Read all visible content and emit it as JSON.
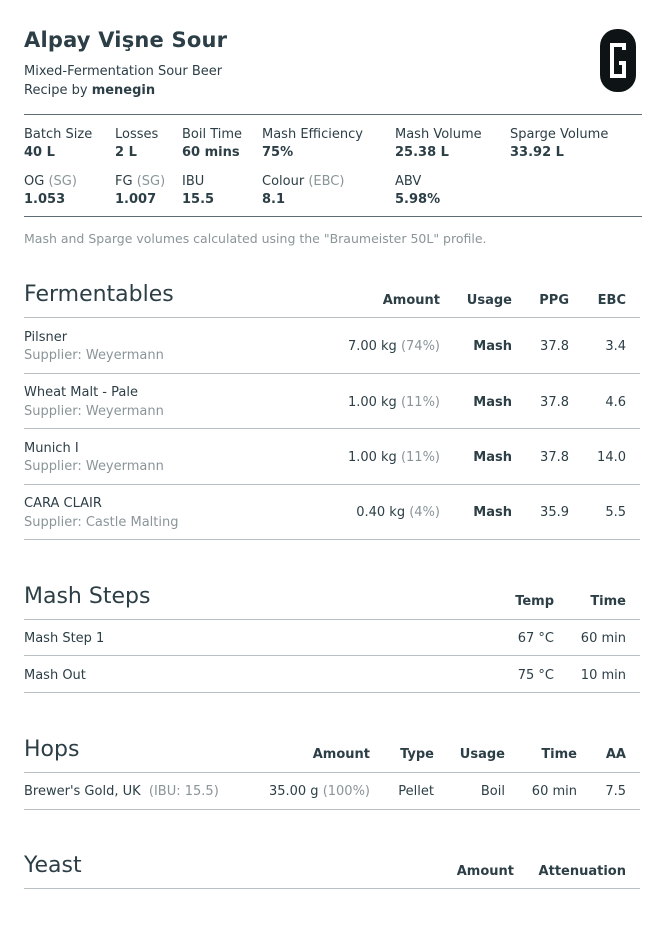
{
  "recipe": {
    "title": "Alpay Vişne Sour",
    "style": "Mixed-Fermentation Sour Beer",
    "byline_prefix": "Recipe by",
    "author": "menegin",
    "logo_icon": "brand-g-logo-icon"
  },
  "stats": {
    "batch_size": {
      "label": "Batch Size",
      "value": "40 L"
    },
    "losses": {
      "label": "Losses",
      "value": "2 L"
    },
    "boil_time": {
      "label": "Boil Time",
      "value": "60 mins"
    },
    "mash_efficiency": {
      "label": "Mash Efficiency",
      "value": "75%"
    },
    "mash_volume": {
      "label": "Mash Volume",
      "value": "25.38 L"
    },
    "sparge_volume": {
      "label": "Sparge Volume",
      "value": "33.92 L"
    },
    "og": {
      "label": "OG",
      "unit": "(SG)",
      "value": "1.053"
    },
    "fg": {
      "label": "FG",
      "unit": "(SG)",
      "value": "1.007"
    },
    "ibu": {
      "label": "IBU",
      "value": "15.5"
    },
    "colour": {
      "label": "Colour",
      "unit": "(EBC)",
      "value": "8.1"
    },
    "abv": {
      "label": "ABV",
      "value": "5.98%"
    }
  },
  "note": "Mash and Sparge volumes calculated using the \"Braumeister 50L\" profile.",
  "fermentables": {
    "title": "Fermentables",
    "headers": {
      "amount": "Amount",
      "usage": "Usage",
      "ppg": "PPG",
      "ebc": "EBC"
    },
    "rows": [
      {
        "name": "Pilsner",
        "supplier": "Supplier: Weyermann",
        "amount": "7.00 kg",
        "pct": "(74%)",
        "usage": "Mash",
        "ppg": "37.8",
        "ebc": "3.4"
      },
      {
        "name": "Wheat Malt - Pale",
        "supplier": "Supplier: Weyermann",
        "amount": "1.00 kg",
        "pct": "(11%)",
        "usage": "Mash",
        "ppg": "37.8",
        "ebc": "4.6"
      },
      {
        "name": "Munich I",
        "supplier": "Supplier: Weyermann",
        "amount": "1.00 kg",
        "pct": "(11%)",
        "usage": "Mash",
        "ppg": "37.8",
        "ebc": "14.0"
      },
      {
        "name": "CARA CLAIR",
        "supplier": "Supplier: Castle Malting",
        "amount": "0.40 kg",
        "pct": "(4%)",
        "usage": "Mash",
        "ppg": "35.9",
        "ebc": "5.5"
      }
    ]
  },
  "mash_steps": {
    "title": "Mash Steps",
    "headers": {
      "temp": "Temp",
      "time": "Time"
    },
    "rows": [
      {
        "name": "Mash Step 1",
        "temp": "67 °C",
        "time": "60 min"
      },
      {
        "name": "Mash Out",
        "temp": "75 °C",
        "time": "10 min"
      }
    ]
  },
  "hops": {
    "title": "Hops",
    "headers": {
      "amount": "Amount",
      "type": "Type",
      "usage": "Usage",
      "time": "Time",
      "aa": "AA"
    },
    "rows": [
      {
        "name": "Brewer's Gold, UK",
        "ibu": "(IBU: 15.5)",
        "amount": "35.00 g",
        "pct": "(100%)",
        "type": "Pellet",
        "usage": "Boil",
        "time": "60 min",
        "aa": "7.5"
      }
    ]
  },
  "yeast": {
    "title": "Yeast",
    "headers": {
      "amount": "Amount",
      "attenuation": "Attenuation"
    }
  }
}
